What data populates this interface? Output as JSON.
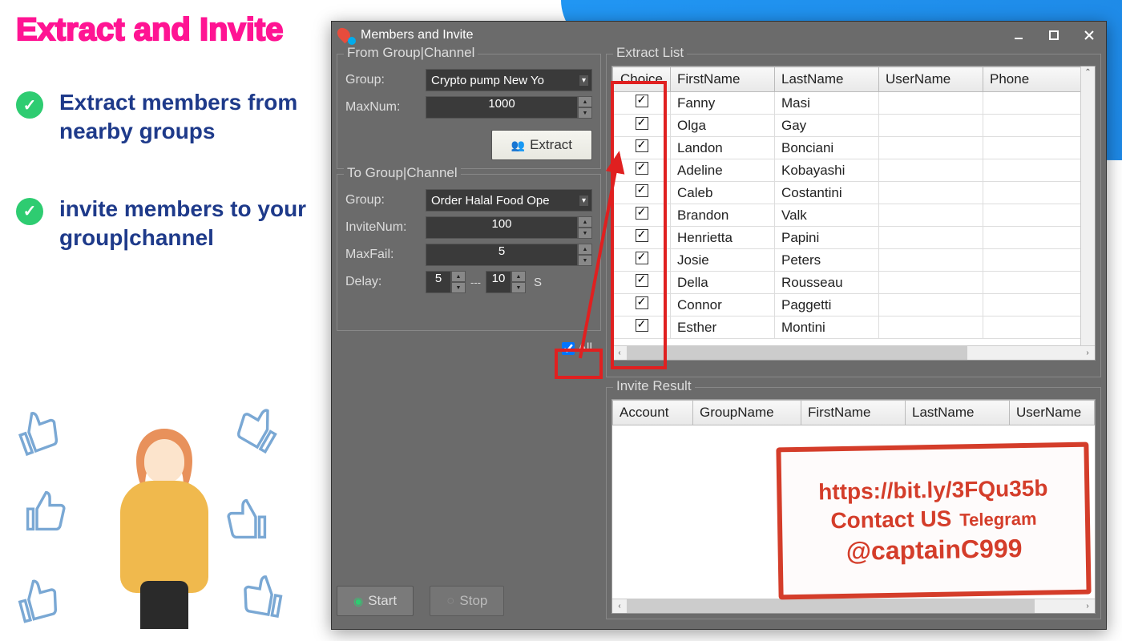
{
  "promo": {
    "title": "Extract and Invite",
    "feature1": "Extract members from nearby groups",
    "feature2": "invite members to your group|channel"
  },
  "window": {
    "title": "Members and Invite"
  },
  "fromGroup": {
    "legend": "From Group|Channel",
    "groupLabel": "Group:",
    "groupValue": "Crypto pump New Yo",
    "maxNumLabel": "MaxNum:",
    "maxNumValue": "1000",
    "extractBtn": "Extract"
  },
  "toGroup": {
    "legend": "To Group|Channel",
    "groupLabel": "Group:",
    "groupValue": "Order Halal Food Ope",
    "inviteNumLabel": "InviteNum:",
    "inviteNumValue": "100",
    "maxFailLabel": "MaxFail:",
    "maxFailValue": "5",
    "delayLabel": "Delay:",
    "delayMin": "5",
    "delayMax": "10",
    "delaySep": "---",
    "delayUnit": "S",
    "allLabel": "All"
  },
  "actions": {
    "start": "Start",
    "stop": "Stop"
  },
  "extractList": {
    "legend": "Extract List",
    "headers": {
      "choice": "Choice",
      "firstName": "FirstName",
      "lastName": "LastName",
      "userName": "UserName",
      "phone": "Phone"
    },
    "rows": [
      {
        "first": "Fanny",
        "last": "Masi",
        "user": "",
        "phone": ""
      },
      {
        "first": "Olga",
        "last": "Gay",
        "user": "",
        "phone": ""
      },
      {
        "first": "Landon",
        "last": "Bonciani",
        "user": "",
        "phone": ""
      },
      {
        "first": "Adeline",
        "last": "Kobayashi",
        "user": "",
        "phone": ""
      },
      {
        "first": "Caleb",
        "last": "Costantini",
        "user": "",
        "phone": ""
      },
      {
        "first": "Brandon",
        "last": "Valk",
        "user": "",
        "phone": ""
      },
      {
        "first": "Henrietta",
        "last": "Papini",
        "user": "",
        "phone": ""
      },
      {
        "first": "Josie",
        "last": "Peters",
        "user": "",
        "phone": ""
      },
      {
        "first": "Della",
        "last": "Rousseau",
        "user": "",
        "phone": ""
      },
      {
        "first": "Connor",
        "last": "Paggetti",
        "user": "",
        "phone": ""
      },
      {
        "first": "Esther",
        "last": "Montini",
        "user": "",
        "phone": ""
      }
    ]
  },
  "inviteResult": {
    "legend": "Invite Result",
    "headers": {
      "account": "Account",
      "groupName": "GroupName",
      "firstName": "FirstName",
      "lastName": "LastName",
      "userName": "UserName"
    }
  },
  "stamp": {
    "url": "https://bit.ly/3FQu35b",
    "contact": "Contact US",
    "telegram": "Telegram",
    "handle": "@captainC999"
  }
}
